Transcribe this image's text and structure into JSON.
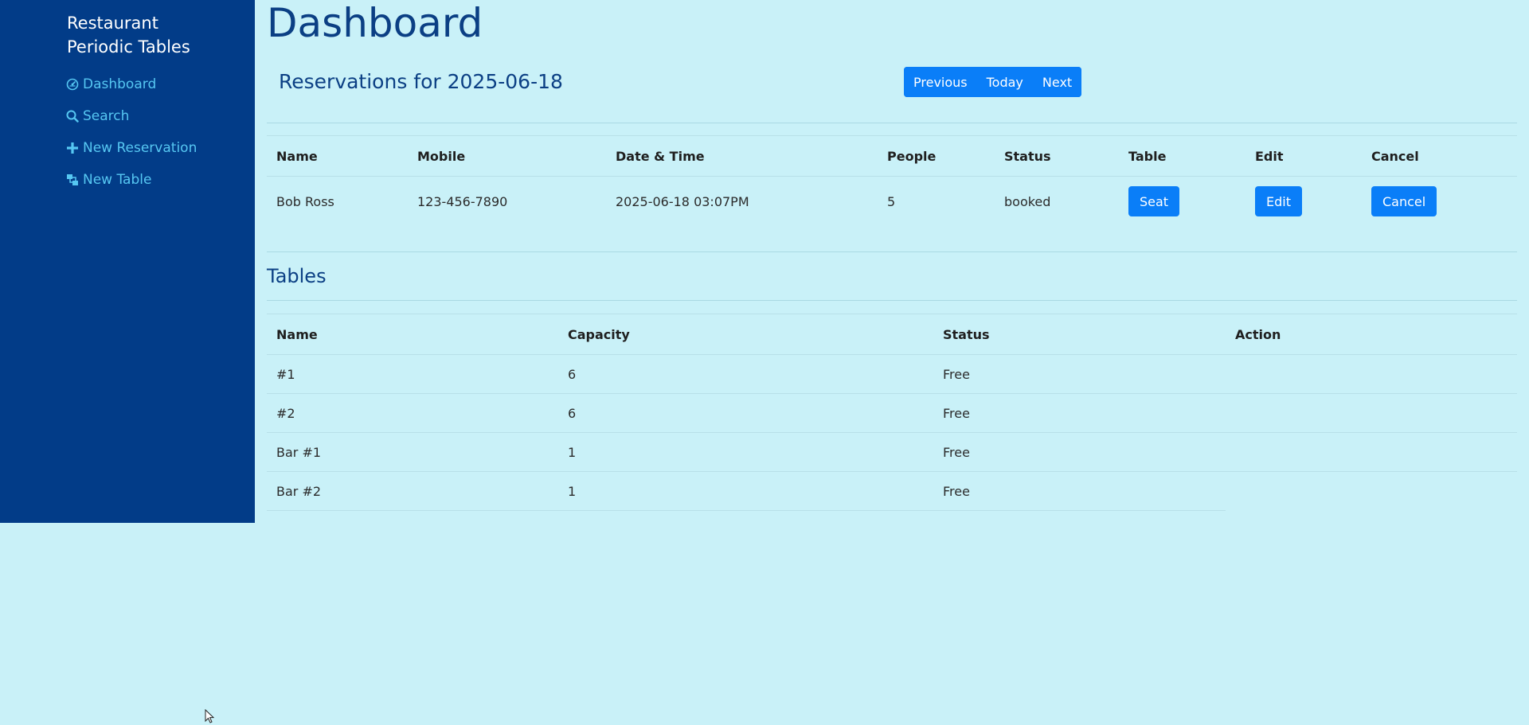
{
  "sidebar": {
    "brand": "Restaurant Periodic Tables",
    "items": [
      {
        "label": "Dashboard",
        "icon": "dashboard-icon"
      },
      {
        "label": "Search",
        "icon": "search-icon"
      },
      {
        "label": "New Reservation",
        "icon": "plus-icon"
      },
      {
        "label": "New Table",
        "icon": "tables-icon"
      }
    ]
  },
  "main": {
    "title": "Dashboard",
    "reservations_heading": "Reservations for 2025-06-18",
    "date_nav": {
      "previous": "Previous",
      "today": "Today",
      "next": "Next"
    },
    "reservations": {
      "headers": [
        "Name",
        "Mobile",
        "Date & Time",
        "People",
        "Status",
        "Table",
        "Edit",
        "Cancel"
      ],
      "rows": [
        {
          "name": "Bob Ross",
          "mobile": "123-456-7890",
          "datetime": "2025-06-18 03:07PM",
          "people": "5",
          "status": "booked",
          "seat_label": "Seat",
          "edit_label": "Edit",
          "cancel_label": "Cancel"
        }
      ]
    },
    "tables_heading": "Tables",
    "tables": {
      "headers": [
        "Name",
        "Capacity",
        "Status",
        "Action"
      ],
      "rows": [
        {
          "name": "#1",
          "capacity": "6",
          "status": "Free"
        },
        {
          "name": "#2",
          "capacity": "6",
          "status": "Free"
        },
        {
          "name": "Bar #1",
          "capacity": "1",
          "status": "Free"
        },
        {
          "name": "Bar #2",
          "capacity": "1",
          "status": "Free"
        }
      ]
    }
  },
  "colors": {
    "background": "#c9f1f8",
    "sidebar": "#023c88",
    "accent": "#0a7ef8",
    "nav_link": "#56c7f2",
    "heading": "#0b3f84"
  }
}
